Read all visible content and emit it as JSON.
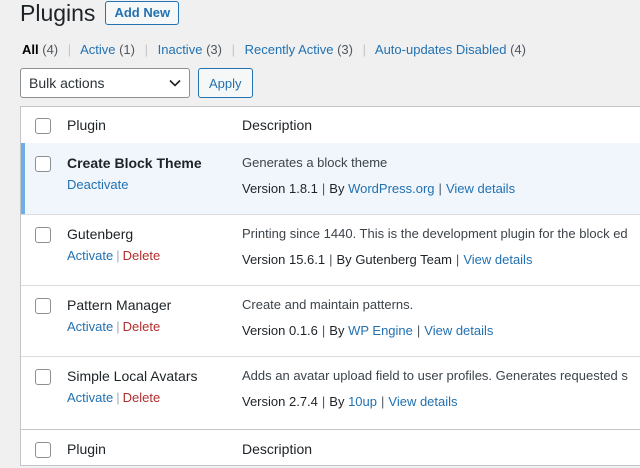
{
  "page": {
    "title": "Plugins",
    "add_new_label": "Add New"
  },
  "filters": [
    {
      "label": "All",
      "count": "(4)",
      "current": true
    },
    {
      "label": "Active",
      "count": "(1)"
    },
    {
      "label": "Inactive",
      "count": "(3)"
    },
    {
      "label": "Recently Active",
      "count": "(3)"
    },
    {
      "label": "Auto-updates Disabled",
      "count": "(4)"
    }
  ],
  "bulk": {
    "selected": "Bulk actions",
    "apply_label": "Apply"
  },
  "table": {
    "col_plugin": "Plugin",
    "col_description": "Description",
    "by_label": "By",
    "view_details_label": "View details",
    "rows": [
      {
        "name": "Create Block Theme",
        "actions": [
          "Deactivate"
        ],
        "description": "Generates a block theme",
        "version": "Version 1.8.1",
        "author": "WordPress.org",
        "active": true
      },
      {
        "name": "Gutenberg",
        "actions": [
          "Activate",
          "Delete"
        ],
        "description": "Printing since 1440. This is the development plugin for the block ed",
        "version": "Version 15.6.1",
        "author": "Gutenberg Team",
        "active": false
      },
      {
        "name": "Pattern Manager",
        "actions": [
          "Activate",
          "Delete"
        ],
        "description": "Create and maintain patterns.",
        "version": "Version 0.1.6",
        "author": "WP Engine",
        "active": false
      },
      {
        "name": "Simple Local Avatars",
        "actions": [
          "Activate",
          "Delete"
        ],
        "description": "Adds an avatar upload field to user profiles. Generates requested s",
        "version": "Version 2.7.4",
        "author": "10up",
        "active": false
      }
    ]
  },
  "colors": {
    "link": "#2271b1",
    "delete": "#b32d2e",
    "active_bg": "#f0f6fc",
    "active_border": "#72aee6"
  }
}
